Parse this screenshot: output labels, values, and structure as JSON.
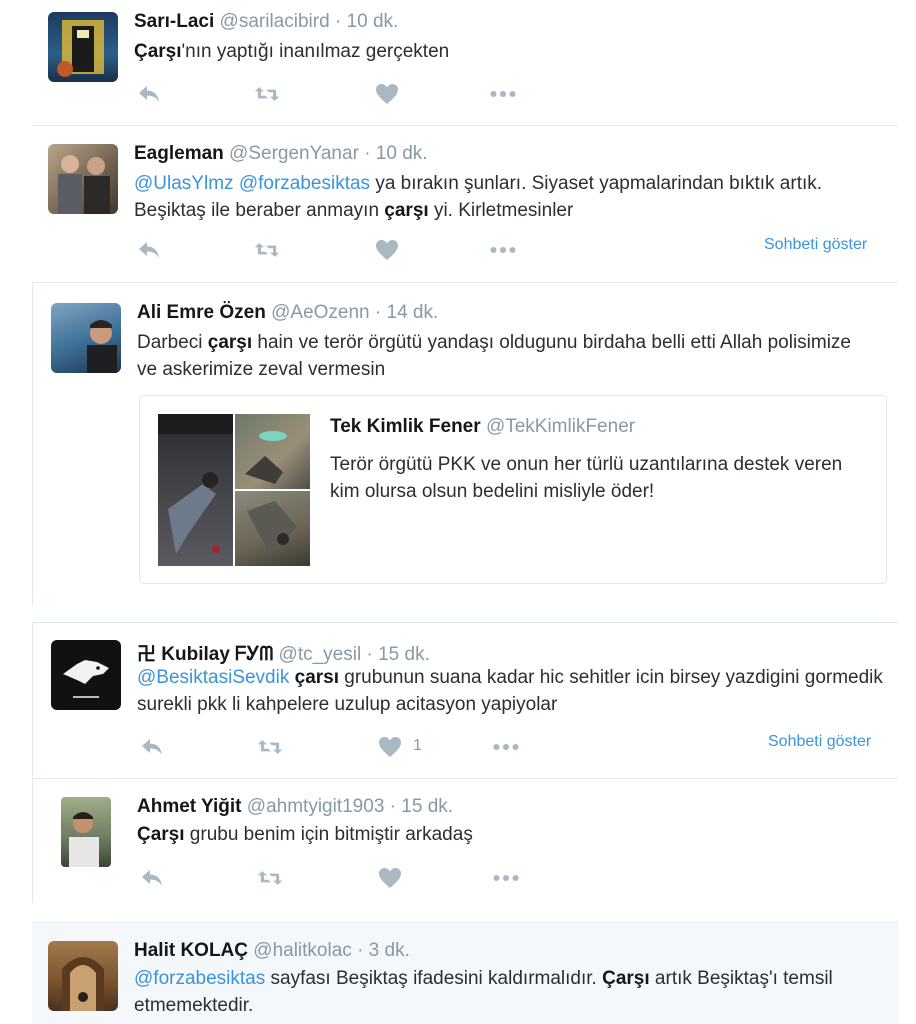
{
  "tweets": [
    {
      "fullname": "Sarı-Laci",
      "username": "@sarilacibird",
      "time": "10 dk.",
      "text": [
        {
          "t": "b",
          "v": "Çarşı"
        },
        {
          "t": "n",
          "v": "'nın yaptığı inanılmaz gerçekten"
        }
      ],
      "conversation": ""
    },
    {
      "fullname": "Eagleman",
      "username": "@SergenYanar",
      "time": "10 dk.",
      "text": [
        {
          "t": "m",
          "v": "@UlasYlmz"
        },
        {
          "t": "n",
          "v": " "
        },
        {
          "t": "m",
          "v": "@forzabesiktas"
        },
        {
          "t": "n",
          "v": " ya bırakın şunları. Siyaset yapmalarindan bıktık artık. Beşiktaş ile beraber anmayın "
        },
        {
          "t": "b",
          "v": "çarşı"
        },
        {
          "t": "n",
          "v": " yi. Kirletmesinler"
        }
      ],
      "conversation": "Sohbeti göster"
    },
    {
      "fullname": "Ali Emre Özen",
      "username": "@AeOzenn",
      "time": "14 dk.",
      "text": [
        {
          "t": "n",
          "v": "Darbeci "
        },
        {
          "t": "b",
          "v": "çarşı"
        },
        {
          "t": "n",
          "v": " hain ve terör örgütü yandaşı oldugunu birdaha belli etti Allah polisimize ve askerimize zeval vermesin"
        }
      ],
      "quote": {
        "fullname": "Tek Kimlik Fener",
        "username": "@TekKimlikFener",
        "text": "Terör örgütü PKK ve onun her türlü uzantılarına destek veren kim olursa olsun bedelini misliyle öder!"
      }
    },
    {
      "fullname_prefix": "卍",
      "fullname": "Kubilay ᖴᎩᗰ",
      "username": "@tc_yesil",
      "time": "15 dk.",
      "text": [
        {
          "t": "m",
          "v": "@BesiktasiSevdik"
        },
        {
          "t": "n",
          "v": " "
        },
        {
          "t": "b",
          "v": "çarsı"
        },
        {
          "t": "n",
          "v": " grubunun suana kadar hic sehitler icin birsey yazdigini gormedik surekli pkk li kahpelere uzulup acitasyon yapiyolar"
        }
      ],
      "like_count": "1",
      "conversation": "Sohbeti göster"
    },
    {
      "fullname": "Ahmet Yiğit",
      "username": "@ahmtyigit1903",
      "time": "15 dk.",
      "text": [
        {
          "t": "b",
          "v": "Çarşı"
        },
        {
          "t": "n",
          "v": " grubu benim için bitmiştir arkadaş"
        }
      ]
    },
    {
      "fullname": "Halit KOLAÇ",
      "username": "@halitkolac",
      "time": "3 dk.",
      "text": [
        {
          "t": "m",
          "v": "@forzabesiktas"
        },
        {
          "t": "n",
          "v": " sayfası Beşiktaş ifadesini kaldırmalıdır. "
        },
        {
          "t": "b",
          "v": "Çarşı"
        },
        {
          "t": "n",
          "v": " artık Beşiktaş'ı temsil etmemektedir."
        }
      ]
    }
  ],
  "meta_separator": "·",
  "icons": {
    "reply": "reply-icon",
    "retweet": "retweet-icon",
    "like": "heart-icon",
    "more": "more-icon"
  },
  "colors": {
    "link": "#3b94d9",
    "muted": "#8899a6",
    "action": "#aab8c2",
    "border": "#e1e8ed"
  }
}
